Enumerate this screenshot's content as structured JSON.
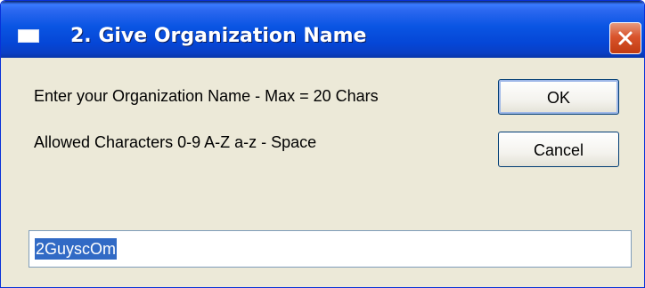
{
  "window": {
    "title": "2. Give Organization Name",
    "icon": "window-icon",
    "close_icon": "close-icon",
    "close_color": "#d9542c",
    "titlebar_color": "#0a55e3"
  },
  "content": {
    "instruction": "Enter your Organization Name - Max = 20 Chars",
    "allowed": "Allowed Characters 0-9 A-Z a-z - Space"
  },
  "buttons": {
    "ok_label": "OK",
    "cancel_label": "Cancel"
  },
  "input": {
    "value": "2GuyscOm",
    "selected": true,
    "selection_color": "#316ac5"
  }
}
